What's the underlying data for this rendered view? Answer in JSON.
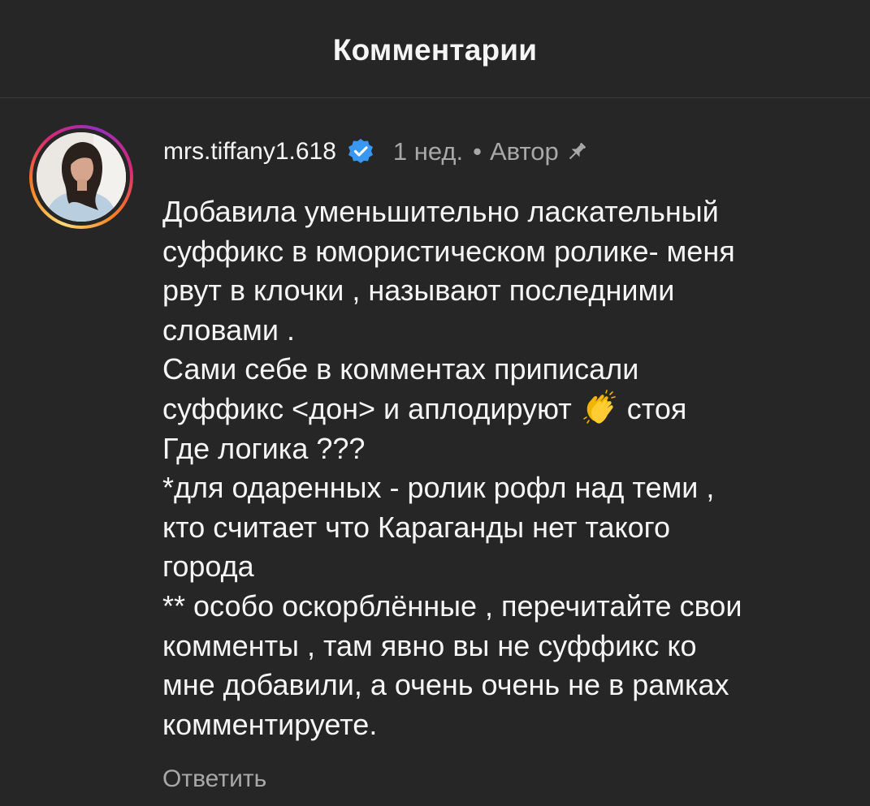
{
  "header": {
    "title": "Комментарии"
  },
  "comment": {
    "username": "mrs.tiffany1.618",
    "verified_icon": "verified-badge-icon",
    "time": "1 нед.",
    "separator": "•",
    "author_label": "Автор",
    "pin_icon": "pin-icon",
    "lines": [
      "Добавила уменьшительно ласкательный",
      "суффикс в юмористическом ролике- меня",
      "рвут в клочки , называют последними",
      "словами .",
      "Сами себе в комментах приписали",
      "Где логика ???",
      "*для одаренных - ролик рофл над теми ,",
      "кто считает что Караганды нет такого",
      "города",
      "** особо оскорблённые , перечитайте свои",
      "комменты , там явно вы не суффикс ко",
      "мне добавили, а очень очень не в рамках",
      "комментируете."
    ],
    "clap_line": {
      "before": "суффикс <дон> и аплодируют ",
      "emoji": "clapping-hands-icon",
      "after": " стоя"
    },
    "reply_label": "Ответить"
  },
  "colors": {
    "background": "#262626",
    "primary_text": "#f5f5f5",
    "secondary_text": "#a8a8a8",
    "verified_blue": "#3897f0",
    "divider": "#3a3a3a"
  }
}
